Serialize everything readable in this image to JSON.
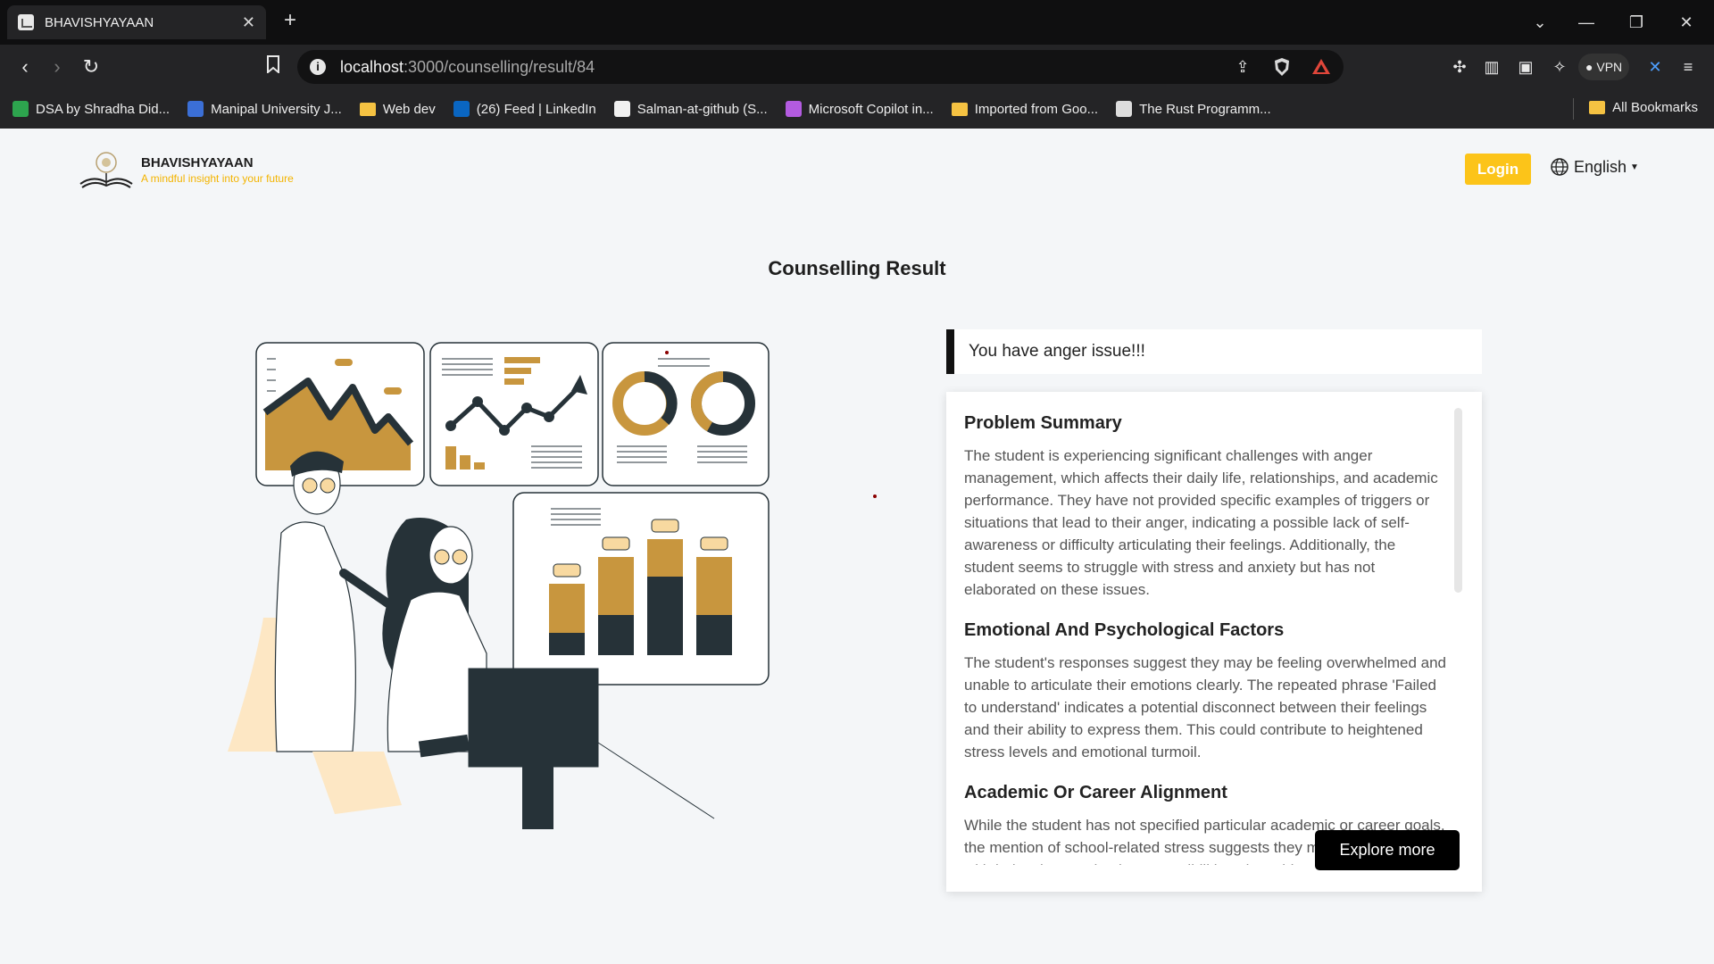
{
  "browser": {
    "tab_title": "BHAVISHYAYAAN",
    "url_host": "localhost",
    "url_path": ":3000/counselling/result/84",
    "vpn_label": "VPN",
    "bookmarks": [
      {
        "label": "DSA by Shradha Did...",
        "icon": "green-plus-icon",
        "color": "#2da44e"
      },
      {
        "label": "Manipal University J...",
        "icon": "c-logo-icon",
        "color": "#3b6fd6"
      },
      {
        "label": "Web dev",
        "icon": "folder-icon",
        "color": "#f5c242"
      },
      {
        "label": "(26) Feed | LinkedIn",
        "icon": "linkedin-icon",
        "color": "#0a66c2"
      },
      {
        "label": "Salman-at-github (S...",
        "icon": "github-icon",
        "color": "#f0f0f0"
      },
      {
        "label": "Microsoft Copilot in...",
        "icon": "copilot-icon",
        "color": "#b35be0"
      },
      {
        "label": "Imported from Goo...",
        "icon": "folder-icon",
        "color": "#f5c242"
      },
      {
        "label": "The Rust Programm...",
        "icon": "book-icon",
        "color": "#dddddd"
      }
    ],
    "all_bookmarks": "All Bookmarks"
  },
  "header": {
    "brand_name": "BHAVISHYAYAAN",
    "brand_tagline": "A mindful insight into your future",
    "login_label": "Login",
    "language": "English"
  },
  "main": {
    "title": "Counselling Result",
    "alert": "You have anger issue!!!",
    "sections": [
      {
        "title": "Problem Summary",
        "body": "The student is experiencing significant challenges with anger management, which affects their daily life, relationships, and academic performance. They have not provided specific examples of triggers or situations that lead to their anger, indicating a possible lack of self-awareness or difficulty articulating their feelings. Additionally, the student seems to struggle with stress and anxiety but has not elaborated on these issues."
      },
      {
        "title": "Emotional And Psychological Factors",
        "body": "The student's responses suggest they may be feeling overwhelmed and unable to articulate their emotions clearly. The repeated phrase 'Failed to understand' indicates a potential disconnect between their feelings and their ability to express them. This could contribute to heightened stress levels and emotional turmoil."
      },
      {
        "title": "Academic Or Career Alignment",
        "body": "While the student has not specified particular academic or career goals, the mention of school-related stress suggests they may be struggling with balancing academic responsibilities alongside"
      }
    ],
    "explore_label": "Explore more"
  },
  "colors": {
    "accent_yellow": "#fcc419",
    "illustration_gold": "#c8963e",
    "illustration_dark": "#263238"
  }
}
